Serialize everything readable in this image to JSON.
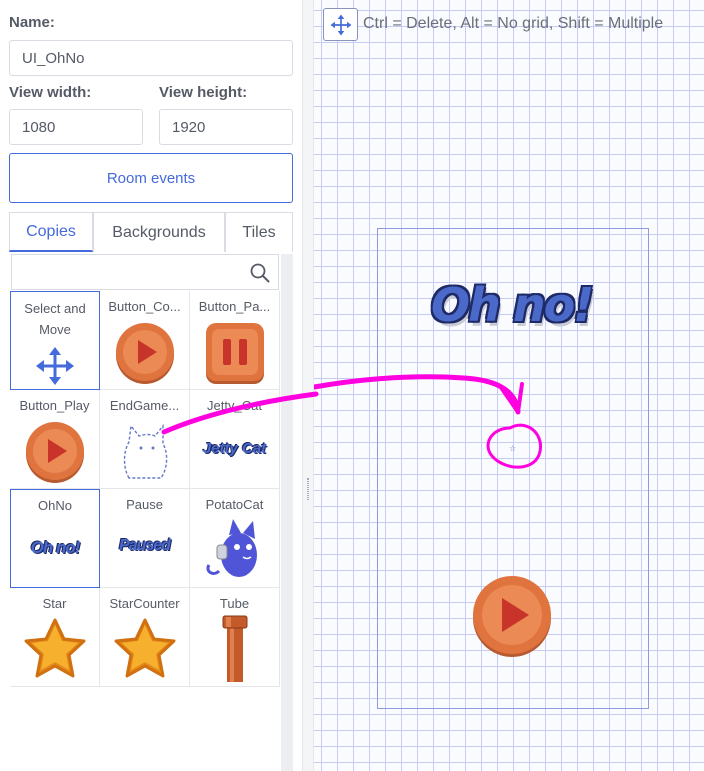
{
  "sidebar": {
    "name_label": "Name:",
    "name_value": "UI_OhNo",
    "view_width_label": "View width:",
    "view_width_value": "1080",
    "view_height_label": "View height:",
    "view_height_value": "1920",
    "room_events_label": "Room events",
    "tabs": [
      {
        "label": "Copies",
        "active": true
      },
      {
        "label": "Backgrounds",
        "active": false
      },
      {
        "label": "Tiles",
        "active": false
      }
    ],
    "search_placeholder": "",
    "templates": [
      {
        "name": "Select and Move",
        "icon": "move-arrows-icon",
        "selected": true
      },
      {
        "name": "Button_Co...",
        "icon": "play-button-icon",
        "selected": false
      },
      {
        "name": "Button_Pa...",
        "icon": "pause-button-icon",
        "selected": false
      },
      {
        "name": "Button_Play",
        "icon": "play-button-icon",
        "selected": false
      },
      {
        "name": "EndGame...",
        "icon": "ghost-cat-outline-icon",
        "selected": false
      },
      {
        "name": "Jetty_Cat",
        "icon": "jetty-cat-logo",
        "thumb_text": "Jetty Cat",
        "selected": false
      },
      {
        "name": "OhNo",
        "icon": "oh-no-text",
        "thumb_text": "Oh no!",
        "selected": true
      },
      {
        "name": "Pause",
        "icon": "paused-text",
        "thumb_text": "Paused",
        "selected": false
      },
      {
        "name": "PotatoCat",
        "icon": "potato-cat-icon",
        "selected": false
      },
      {
        "name": "Star",
        "icon": "star-icon",
        "selected": false
      },
      {
        "name": "StarCounter",
        "icon": "star-icon",
        "selected": false
      },
      {
        "name": "Tube",
        "icon": "tube-pipe-icon",
        "selected": false
      }
    ]
  },
  "canvas": {
    "hint": "Ctrl = Delete, Alt = No grid, Shift = Multiple",
    "title_copy": "Oh no!",
    "tiny_copy_glyph": "☆",
    "colors": {
      "accent": "#446adb",
      "annotation": "#ff00e0",
      "button_orange": "#e0743f",
      "play_red": "#c8342a",
      "grid": "#c7cdf2",
      "star_gold": "#f4a020"
    }
  }
}
